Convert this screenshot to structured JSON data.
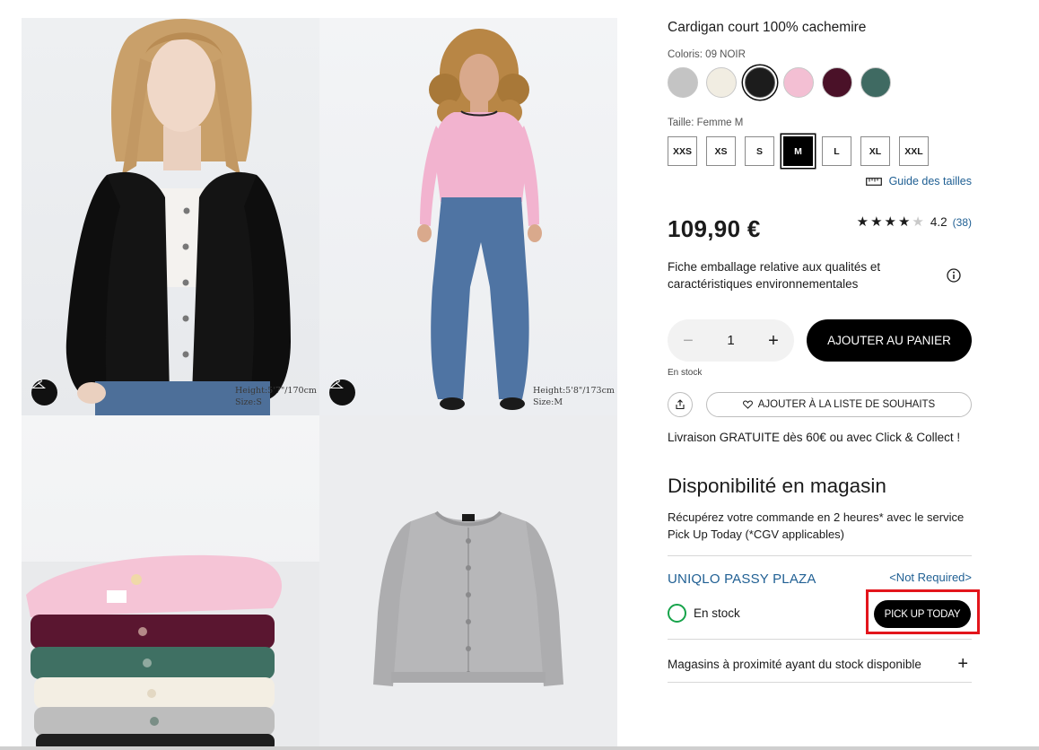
{
  "gallery": {
    "images": [
      {
        "name": "Femme en cardigan noir",
        "model_info": [
          "Height:5'7\"/170cm",
          "Size:S"
        ]
      },
      {
        "name": "Femme en cardigan rose",
        "model_info": [
          "Height:5'8\"/173cm",
          "Size:M"
        ]
      },
      {
        "name": "Pile de cardigans de couleurs"
      },
      {
        "name": "Cardigan gris à plat"
      }
    ]
  },
  "product": {
    "title": "Cardigan court 100% cachemire",
    "color_label": "Coloris: 09 NOIR",
    "colors": [
      {
        "hex": "#c4c4c4",
        "selected": false
      },
      {
        "hex": "#f1ede2",
        "selected": false
      },
      {
        "hex": "#1c1c1c",
        "selected": true
      },
      {
        "hex": "#f3bfd3",
        "selected": false
      },
      {
        "hex": "#4a1128",
        "selected": false
      },
      {
        "hex": "#3f6a62",
        "selected": false
      }
    ],
    "size_label": "Taille: Femme M",
    "sizes": [
      "XXS",
      "XS",
      "S",
      "M",
      "L",
      "XL",
      "XXL"
    ],
    "selected_size": "M",
    "size_guide": "Guide des tailles",
    "price": "109,90 €",
    "rating": {
      "value": "4.2",
      "count": "(38)",
      "stars": 4
    },
    "eco_info": "Fiche emballage relative aux qualités et caractéristiques environnementales",
    "quantity": "1",
    "add_to_cart": "AJOUTER AU PANIER",
    "stock_status": "En stock",
    "wishlist": "AJOUTER À LA LISTE DE SOUHAITS",
    "delivery": "Livraison GRATUITE dès 60€ ou avec Click & Collect !"
  },
  "store": {
    "title": "Disponibilité en magasin",
    "description": "Récupérez votre commande en 2 heures* avec le service Pick Up Today (*CGV applicables)",
    "name": "UNIQLO PASSY PLAZA",
    "not_required": "<Not Required>",
    "stock": "En stock",
    "pickup_button": "PICK UP TODAY",
    "nearby": "Magasins à proximité ayant du stock disponible"
  },
  "colors": {
    "accent_blue": "#1f5f93",
    "stock_green": "#16a34a",
    "highlight_red": "#e3151c"
  }
}
